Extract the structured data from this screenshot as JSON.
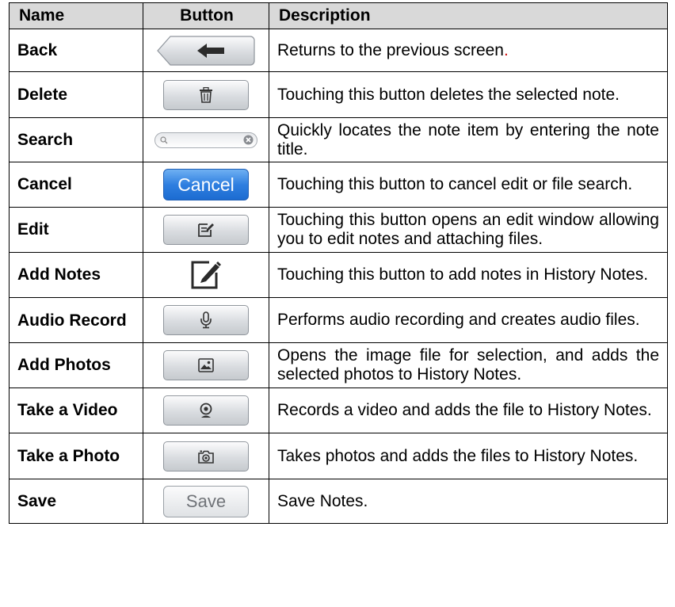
{
  "header": {
    "name": "Name",
    "button": "Button",
    "description": "Description"
  },
  "rows": [
    {
      "name": "Back",
      "icon": "back-arrow-icon",
      "description": "Returns to the previous screen",
      "description_suffix": "."
    },
    {
      "name": "Delete",
      "icon": "trash-icon",
      "description": "Touching this button deletes the selected note."
    },
    {
      "name": "Search",
      "icon": "search-bar",
      "description": "Quickly locates the note item by entering the note title."
    },
    {
      "name": "Cancel",
      "button_label": "Cancel",
      "description": "Touching this button to cancel edit or file search."
    },
    {
      "name": "Edit",
      "icon": "edit-icon",
      "description": "Touching this button opens an edit window allowing you to edit notes and attaching files."
    },
    {
      "name": "Add Notes",
      "icon": "add-note-icon",
      "description": "Touching this button to add notes in History Notes."
    },
    {
      "name": "Audio Record",
      "icon": "microphone-icon",
      "description": "Performs audio recording and creates audio files."
    },
    {
      "name": "Add Photos",
      "icon": "image-icon",
      "description": "Opens the image file for selection, and adds the selected photos to History Notes."
    },
    {
      "name": "Take a Video",
      "icon": "webcam-icon",
      "description": "Records a video and adds the file to History Notes."
    },
    {
      "name": "Take a Photo",
      "icon": "camera-icon",
      "description": "Takes photos and adds the files to History Notes."
    },
    {
      "name": "Save",
      "button_label": "Save",
      "description": "Save Notes."
    }
  ],
  "colors": {
    "header_bg": "#d9d9d9",
    "cancel_blue": "#2f7fe0",
    "period_red": "#d01010"
  }
}
